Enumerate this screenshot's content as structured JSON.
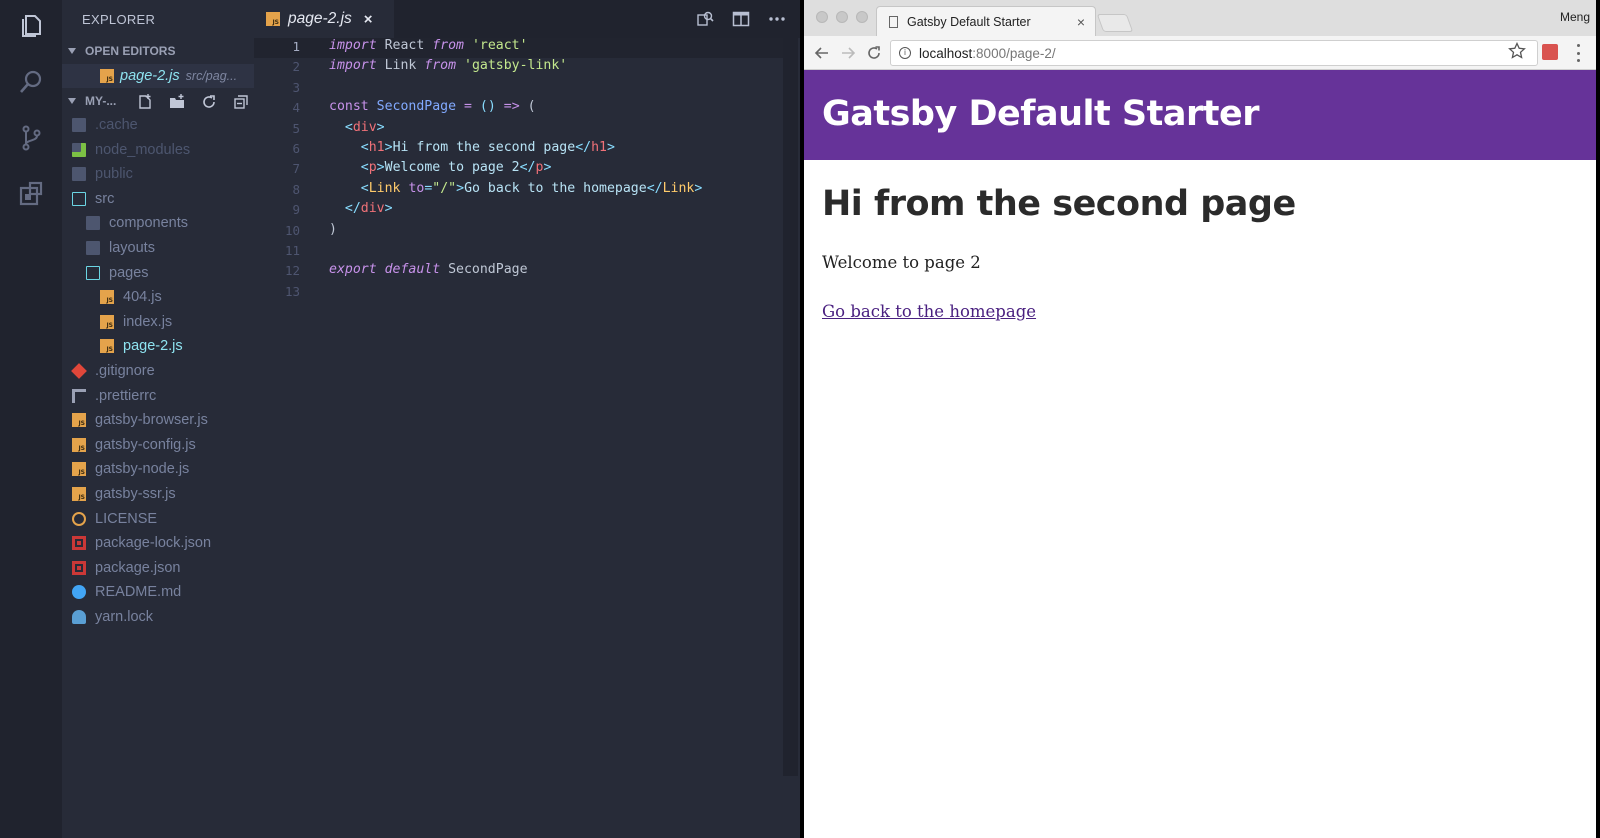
{
  "vscode": {
    "explorer_title": "EXPLORER",
    "open_editors_label": "OPEN EDITORS",
    "open_editor": {
      "name": "page-2.js",
      "path": "src/pag..."
    },
    "project_label": "MY-...",
    "tree": [
      {
        "name": ".cache",
        "kind": "folder",
        "color": "#4d566f"
      },
      {
        "name": "node_modules",
        "kind": "folder-node",
        "color": "#4d566f"
      },
      {
        "name": "public",
        "kind": "folder",
        "color": "#4d566f"
      },
      {
        "name": "src",
        "kind": "folder-open",
        "color": "#78829e"
      },
      {
        "name": "components",
        "kind": "folder",
        "color": "#78829e"
      },
      {
        "name": "layouts",
        "kind": "folder",
        "color": "#78829e"
      },
      {
        "name": "pages",
        "kind": "folder-open",
        "color": "#78829e"
      },
      {
        "name": "404.js",
        "kind": "js",
        "color": "#78829e"
      },
      {
        "name": "index.js",
        "kind": "js",
        "color": "#78829e"
      },
      {
        "name": "page-2.js",
        "kind": "js",
        "color": "#8ee3f0"
      },
      {
        "name": ".gitignore",
        "kind": "git",
        "color": "#78829e"
      },
      {
        "name": ".prettierrc",
        "kind": "prettier",
        "color": "#78829e"
      },
      {
        "name": "gatsby-browser.js",
        "kind": "js",
        "color": "#78829e"
      },
      {
        "name": "gatsby-config.js",
        "kind": "js",
        "color": "#78829e"
      },
      {
        "name": "gatsby-node.js",
        "kind": "js",
        "color": "#78829e"
      },
      {
        "name": "gatsby-ssr.js",
        "kind": "js",
        "color": "#78829e"
      },
      {
        "name": "LICENSE",
        "kind": "license",
        "color": "#78829e"
      },
      {
        "name": "package-lock.json",
        "kind": "npm-lock",
        "color": "#78829e"
      },
      {
        "name": "package.json",
        "kind": "npm",
        "color": "#78829e"
      },
      {
        "name": "README.md",
        "kind": "info",
        "color": "#78829e"
      },
      {
        "name": "yarn.lock",
        "kind": "yarn",
        "color": "#78829e"
      }
    ],
    "tab": {
      "name": "page-2.js",
      "close": "×"
    },
    "line_numbers": [
      "1",
      "2",
      "3",
      "4",
      "5",
      "6",
      "7",
      "8",
      "9",
      "10",
      "11",
      "12",
      "13"
    ]
  },
  "browser": {
    "tab_title": "Gatsby Default Starter",
    "tab_close": "×",
    "user": "Meng",
    "url_host": "localhost",
    "url_rest": ":8000/page-2/",
    "site_title": "Gatsby Default Starter",
    "page_heading": "Hi from the second page",
    "page_text": "Welcome to page 2",
    "page_link": "Go back to the homepage"
  },
  "colors": {
    "gatsby_purple": "#663399",
    "editor_bg": "#272b38",
    "accent_cyan": "#8ee3f0"
  }
}
